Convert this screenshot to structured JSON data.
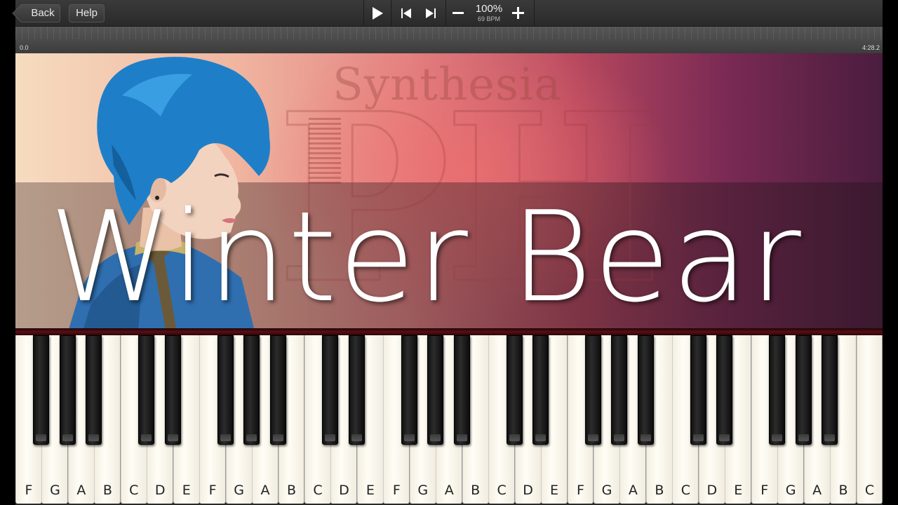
{
  "toolbar": {
    "back_label": "Back",
    "help_label": "Help",
    "speed": "100%",
    "bpm": "69 BPM"
  },
  "timeline": {
    "start_time": "0.0",
    "end_time": "4:28.2"
  },
  "banner": {
    "song_title": "Winter Bear",
    "watermark": "Synthesia",
    "watermark_logo": "PH"
  },
  "keyboard": {
    "white_keys": [
      "F",
      "G",
      "A",
      "B",
      "C",
      "D",
      "E",
      "F",
      "G",
      "A",
      "B",
      "C",
      "D",
      "E",
      "F",
      "G",
      "A",
      "B",
      "C",
      "D",
      "E",
      "F",
      "G",
      "A",
      "B",
      "C",
      "D",
      "E",
      "F",
      "G",
      "A",
      "B",
      "C"
    ],
    "black_key_count": 23
  },
  "colors": {
    "toolbar_bg": "#2f2f2f",
    "divider": "#5a0f14",
    "hair": "#1e7fc8"
  }
}
